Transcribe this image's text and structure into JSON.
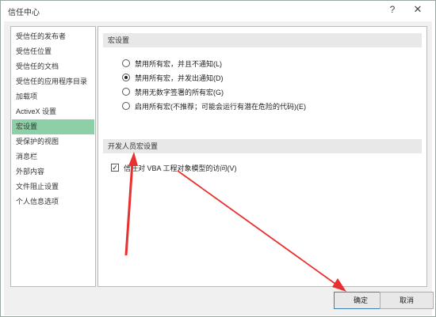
{
  "window": {
    "title": "信任中心",
    "help": "?",
    "close": "✕"
  },
  "sidebar": {
    "items": [
      {
        "label": "受信任的发布者"
      },
      {
        "label": "受信任位置"
      },
      {
        "label": "受信任的文档"
      },
      {
        "label": "受信任的应用程序目录"
      },
      {
        "label": "加载项"
      },
      {
        "label": "ActiveX 设置"
      },
      {
        "label": "宏设置"
      },
      {
        "label": "受保护的视图"
      },
      {
        "label": "消息栏"
      },
      {
        "label": "外部内容"
      },
      {
        "label": "文件阻止设置"
      },
      {
        "label": "个人信息选项"
      }
    ],
    "selected_index": 6
  },
  "macro_settings": {
    "heading": "宏设置",
    "options": [
      {
        "label": "禁用所有宏，并且不通知(L)",
        "selected": false
      },
      {
        "label": "禁用所有宏，并发出通知(D)",
        "selected": true
      },
      {
        "label": "禁用无数字签署的所有宏(G)",
        "selected": false
      },
      {
        "label": "启用所有宏(不推荐；可能会运行有潜在危险的代码)(E)",
        "selected": false
      }
    ]
  },
  "developer_settings": {
    "heading": "开发人员宏设置",
    "checkbox_label": "信任对 VBA 工程对象模型的访问(V)",
    "checked": true,
    "check_mark": "✓"
  },
  "buttons": {
    "ok": "确定",
    "cancel": "取消"
  },
  "colors": {
    "selected_nav": "#8dd0a8",
    "annotation_arrow": "#e8302f"
  }
}
